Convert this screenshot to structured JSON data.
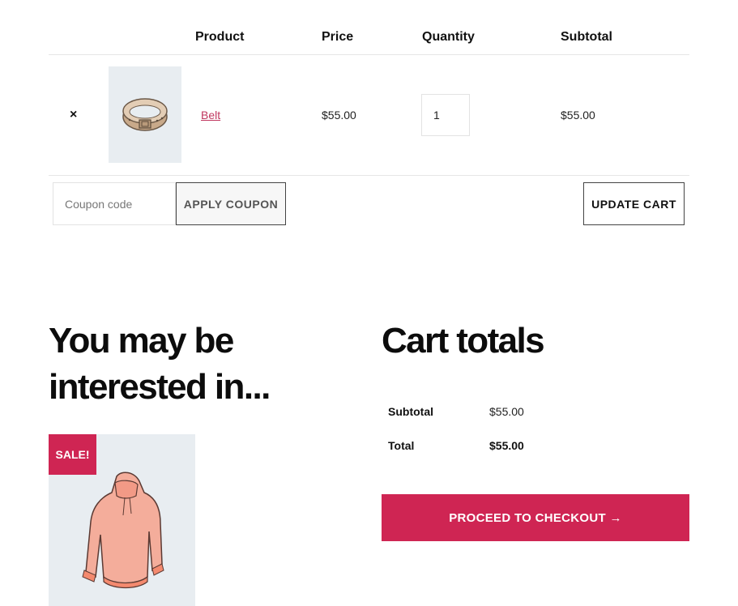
{
  "cart": {
    "headers": {
      "product": "Product",
      "price": "Price",
      "quantity": "Quantity",
      "subtotal": "Subtotal"
    },
    "items": [
      {
        "remove": "×",
        "name": "Belt",
        "price": "$55.00",
        "quantity": "1",
        "subtotal": "$55.00",
        "image_icon": "belt-icon"
      }
    ],
    "coupon_placeholder": "Coupon code",
    "apply_coupon": "APPLY COUPON",
    "update_cart": "UPDATE CART"
  },
  "recommendations": {
    "title": "You may be interested in...",
    "products": [
      {
        "badge": "SALE!",
        "image_icon": "hoodie-icon"
      }
    ]
  },
  "totals": {
    "title": "Cart totals",
    "subtotal_label": "Subtotal",
    "subtotal_value": "$55.00",
    "total_label": "Total",
    "total_value": "$55.00",
    "checkout_button": "PROCEED TO CHECKOUT →"
  },
  "colors": {
    "accent": "#cf2553",
    "link": "#c0375f",
    "thumb_bg": "#e8edf1"
  }
}
